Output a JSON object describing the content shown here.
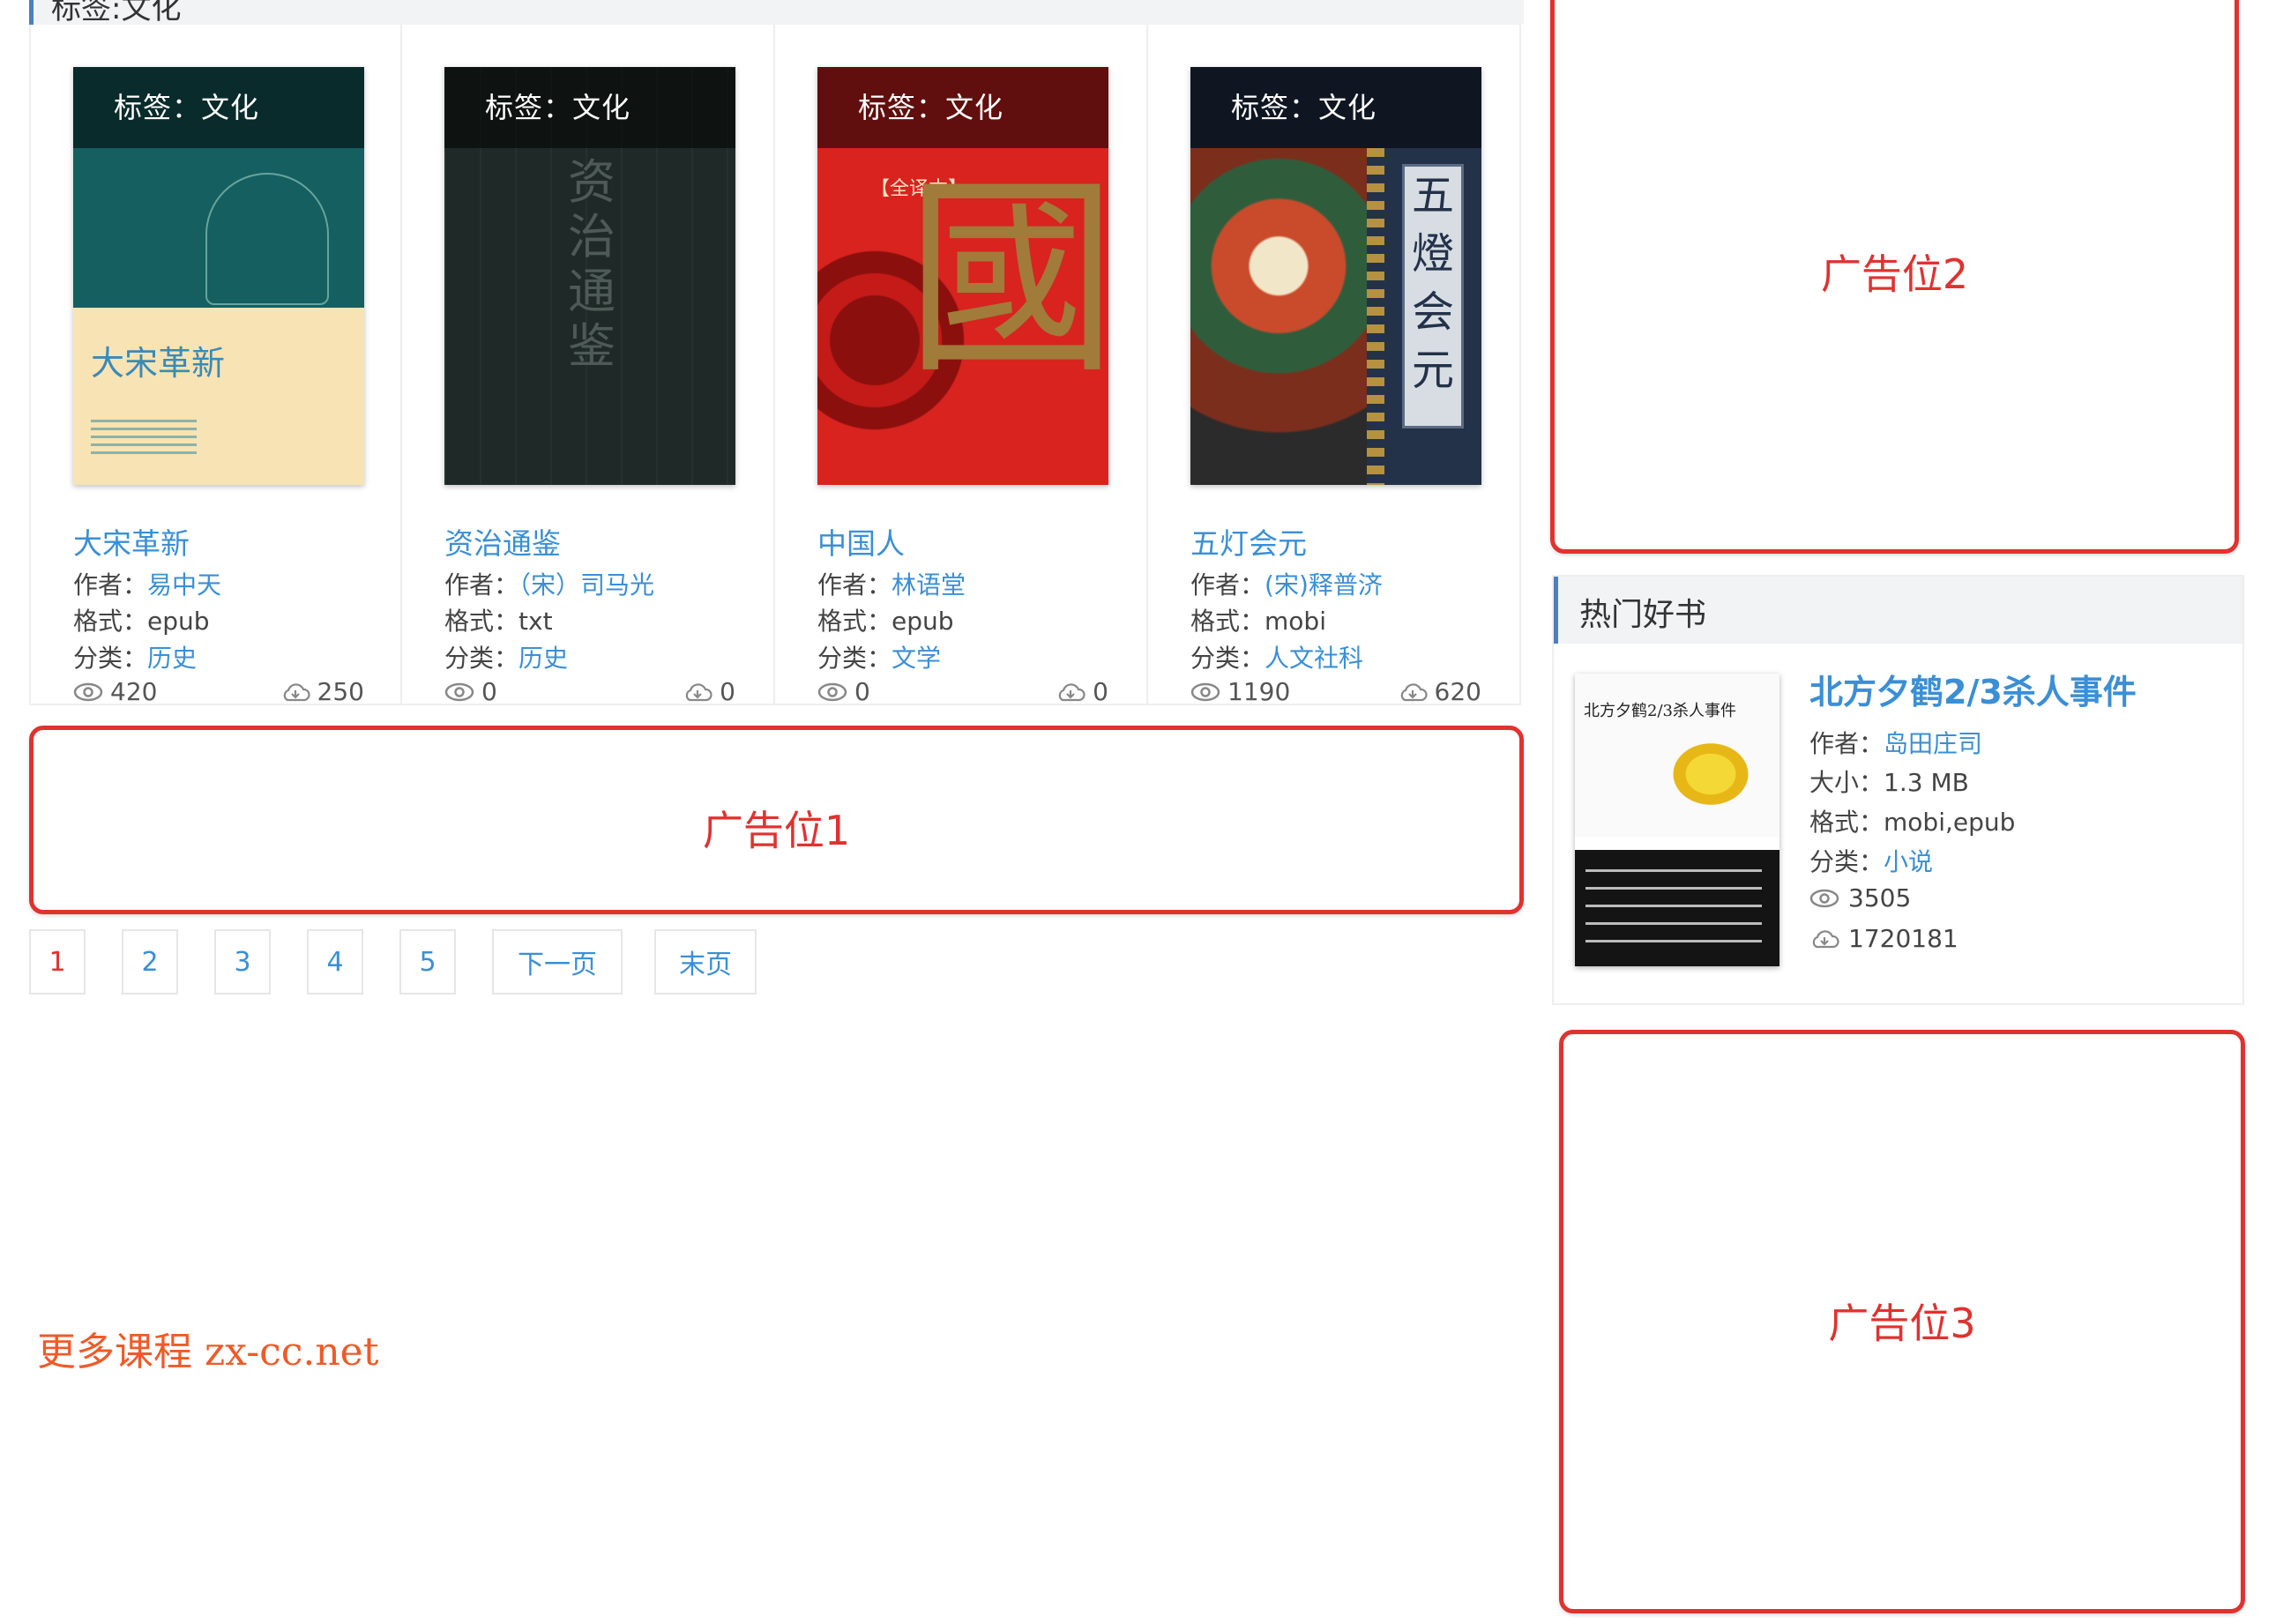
{
  "section": {
    "title": "标签:文化"
  },
  "books": [
    {
      "cover_tag": "标签：文化",
      "cover_text": "大宋革新",
      "title": "大宋革新",
      "author_label": "作者：",
      "author": "易中天",
      "format_label": "格式：",
      "format": "epub",
      "category_label": "分类：",
      "category": "历史",
      "views": "420",
      "downloads": "250"
    },
    {
      "cover_tag": "标签：文化",
      "cover_text": "资治通鉴",
      "title": "资治通鉴",
      "author_label": "作者：",
      "author": "（宋）司马光",
      "format_label": "格式：",
      "format": "txt",
      "category_label": "分类：",
      "category": "历史",
      "views": "0",
      "downloads": "0"
    },
    {
      "cover_tag": "标签：文化",
      "cover_text": "國",
      "cover_subtext": "【全译本】",
      "title": "中国人",
      "author_label": "作者：",
      "author": "林语堂",
      "format_label": "格式：",
      "format": "epub",
      "category_label": "分类：",
      "category": "文学",
      "views": "0",
      "downloads": "0"
    },
    {
      "cover_tag": "标签：文化",
      "cover_text": "五燈会元",
      "title": "五灯会元",
      "author_label": "作者：",
      "author": "(宋)释普济",
      "format_label": "格式：",
      "format": "mobi",
      "category_label": "分类：",
      "category": "人文社科",
      "views": "1190",
      "downloads": "620"
    }
  ],
  "ads": {
    "ad1": "广告位1",
    "ad2": "广告位2",
    "ad3": "广告位3"
  },
  "pagination": {
    "pages": [
      "1",
      "2",
      "3",
      "4",
      "5"
    ],
    "current": "1",
    "next": "下一页",
    "last": "末页"
  },
  "hot": {
    "header": "热门好书",
    "cover_text": "北方夕鹤2/3杀人事件",
    "title": "北方夕鹤2/3杀人事件",
    "author_label": "作者：",
    "author": "岛田庄司",
    "size_label": "大小：",
    "size": "1.3 MB",
    "format_label": "格式：",
    "format": "mobi,epub",
    "category_label": "分类：",
    "category": "小说",
    "views": "3505",
    "downloads": "1720181"
  },
  "watermark": "更多课程 zx-cc.net",
  "colors": {
    "link": "#3a8fd6",
    "ad_border": "#e0322f",
    "accent_bar": "#4a7fc1",
    "watermark": "#f05a28"
  },
  "icons": [
    "eye-icon",
    "cloud-download-icon"
  ]
}
